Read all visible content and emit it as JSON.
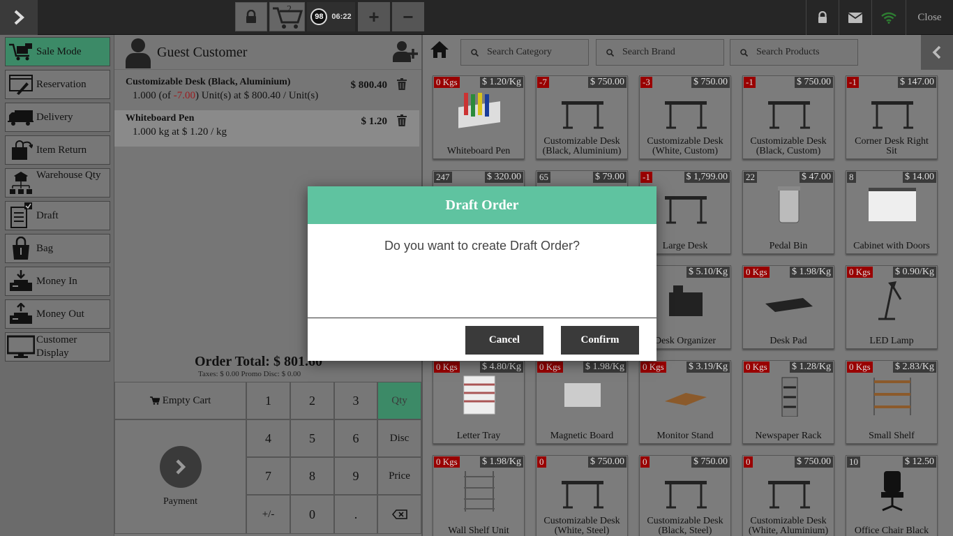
{
  "topbar": {
    "cart_count": "2",
    "session_number": "98",
    "session_time": "06:22",
    "plus_label": "+",
    "minus_label": "−",
    "close_label": "Close"
  },
  "sidebar": {
    "items": [
      {
        "label": "Sale Mode",
        "icon": "sale-mode-icon"
      },
      {
        "label": "Reservation",
        "icon": "reservation-icon"
      },
      {
        "label": "Delivery",
        "icon": "delivery-truck-icon"
      },
      {
        "label": "Item Return",
        "icon": "item-return-icon"
      },
      {
        "label": "Warehouse Qty",
        "icon": "warehouse-icon"
      },
      {
        "label": "Draft",
        "icon": "draft-icon"
      },
      {
        "label": "Bag",
        "icon": "bag-icon"
      },
      {
        "label": "Money In",
        "icon": "money-in-icon"
      },
      {
        "label": "Money Out",
        "icon": "money-out-icon"
      },
      {
        "label": "Customer Display",
        "icon": "monitor-icon"
      }
    ]
  },
  "order": {
    "customer": "Guest Customer",
    "lines": [
      {
        "name": "Customizable Desk (Black, Aluminium)",
        "price": "$ 800.40",
        "detail_pre": "1.000 (of ",
        "detail_red": "-7.00",
        "detail_post": ") Unit(s) at $ 800.40 / Unit(s)"
      },
      {
        "name": "Whiteboard Pen",
        "price": "$ 1.20",
        "detail": "1.000 kg at $ 1.20 / kg"
      }
    ],
    "total": "Order Total: $ 801.60",
    "taxes": "Taxes: $ 0.00   Promo Disc: $ 0.00"
  },
  "numpad": {
    "empty_cart": "Empty Cart",
    "payment": "Payment",
    "keys": [
      "1",
      "2",
      "3",
      "4",
      "5",
      "6",
      "7",
      "8",
      "9",
      "+/-",
      "0",
      "."
    ],
    "modes": [
      "Qty",
      "Disc",
      "Price"
    ]
  },
  "search": {
    "category": "Search Category",
    "brand": "Search Brand",
    "products": "Search Products"
  },
  "products": [
    {
      "name": "Whiteboard Pen",
      "qty": "0 Kgs",
      "price": "$ 1.20/Kg"
    },
    {
      "name": "Customizable Desk (Black, Aluminium)",
      "qty": "-7",
      "price": "$ 750.00"
    },
    {
      "name": "Customizable Desk (White, Custom)",
      "qty": "-3",
      "price": "$ 750.00"
    },
    {
      "name": "Customizable Desk (Black, Custom)",
      "qty": "-1",
      "price": "$ 750.00"
    },
    {
      "name": "Corner Desk Right Sit",
      "qty": "-1",
      "price": "$ 147.00"
    },
    {
      "name": "",
      "qty": "247",
      "price": "$ 320.00"
    },
    {
      "name": "",
      "qty": "65",
      "price": "$ 79.00"
    },
    {
      "name": "Large Desk",
      "qty": "-1",
      "price": "$ 1,799.00"
    },
    {
      "name": "Pedal Bin",
      "qty": "22",
      "price": "$ 47.00"
    },
    {
      "name": "Cabinet with Doors",
      "qty": "8",
      "price": "$ 14.00"
    },
    {
      "name": "",
      "qty": "",
      "price": ""
    },
    {
      "name": "",
      "qty": "",
      "price": ""
    },
    {
      "name": "Desk Organizer",
      "qty": "gs",
      "price": "$ 5.10/Kg"
    },
    {
      "name": "Desk Pad",
      "qty": "0 Kgs",
      "price": "$ 1.98/Kg"
    },
    {
      "name": "LED Lamp",
      "qty": "0 Kgs",
      "price": "$ 0.90/Kg"
    },
    {
      "name": "Letter Tray",
      "qty": "0 Kgs",
      "price": "$ 4.80/Kg"
    },
    {
      "name": "Magnetic Board",
      "qty": "0 Kgs",
      "price": "$ 1.98/Kg"
    },
    {
      "name": "Monitor Stand",
      "qty": "0 Kgs",
      "price": "$ 3.19/Kg"
    },
    {
      "name": "Newspaper Rack",
      "qty": "0 Kgs",
      "price": "$ 1.28/Kg"
    },
    {
      "name": "Small Shelf",
      "qty": "0 Kgs",
      "price": "$ 2.83/Kg"
    },
    {
      "name": "Wall Shelf Unit",
      "qty": "0 Kgs",
      "price": "$ 1.98/Kg"
    },
    {
      "name": "Customizable Desk (White, Steel)",
      "qty": "0",
      "price": "$ 750.00"
    },
    {
      "name": "Customizable Desk (Black, Steel)",
      "qty": "0",
      "price": "$ 750.00"
    },
    {
      "name": "Customizable Desk (White, Aluminium)",
      "qty": "0",
      "price": "$ 750.00"
    },
    {
      "name": "Office Chair Black",
      "qty": "10",
      "price": "$ 12.50"
    }
  ],
  "modal": {
    "title": "Draft Order",
    "message": "Do you want to create Draft Order?",
    "cancel": "Cancel",
    "confirm": "Confirm"
  }
}
